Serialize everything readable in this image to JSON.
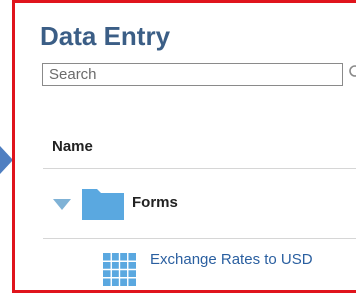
{
  "panel": {
    "title": "Data Entry",
    "search": {
      "placeholder": "Search",
      "icon": "magnifier-icon"
    },
    "column_header": "Name",
    "tree": {
      "folder": {
        "label": "Forms",
        "expanded": true,
        "icon": "folder-icon"
      },
      "items": [
        {
          "label": "Exchange Rates to USD",
          "icon": "form-grid-icon"
        }
      ]
    }
  },
  "colors": {
    "frame": "#e0141c",
    "title": "#3b5e86",
    "link": "#2a5fa0",
    "folder": "#5aa8e0",
    "pointer": "#4f7fc1"
  }
}
